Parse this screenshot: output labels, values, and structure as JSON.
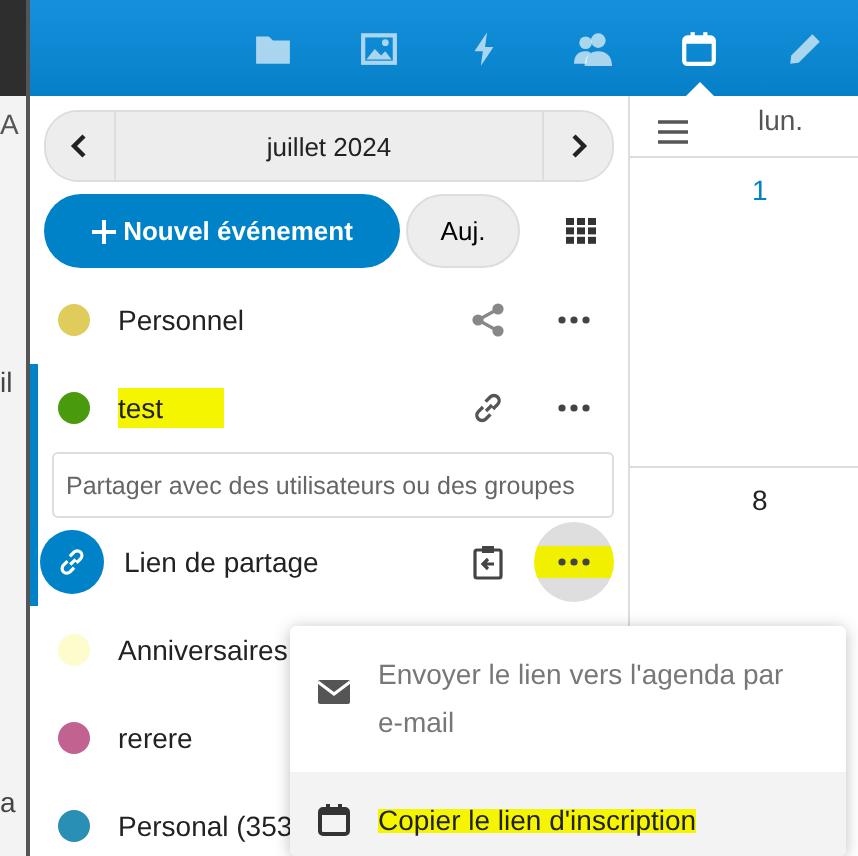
{
  "background_window": {
    "fragments": [
      "A",
      "il",
      "a"
    ]
  },
  "app_menu": [
    {
      "kind": "folder",
      "selected": false
    },
    {
      "kind": "image",
      "selected": false
    },
    {
      "kind": "bolt",
      "selected": false
    },
    {
      "kind": "people",
      "selected": false
    },
    {
      "kind": "calendar",
      "selected": true
    },
    {
      "kind": "pencil",
      "selected": false
    }
  ],
  "month_nav": {
    "label": "juillet 2024"
  },
  "new_event_button": {
    "label": "Nouvel événement"
  },
  "today_button": {
    "label": "Auj."
  },
  "calendars": [
    {
      "name": "Personnel",
      "color": "#e0cc5a",
      "kind": "share",
      "selected": false,
      "highlighted": false
    },
    {
      "name": "test",
      "color": "#4a9a0e",
      "kind": "link",
      "selected": true,
      "highlighted": true,
      "sharing": {
        "placeholder": "Partager avec des utilisateurs ou des groupes",
        "link_label": "Lien de partage",
        "link_highlighted": true
      }
    },
    {
      "name": "Anniversaires",
      "color": "#fcfccc",
      "kind": "plain",
      "selected": false,
      "highlighted": false
    },
    {
      "name": "rerere",
      "color": "#c16290",
      "kind": "plain",
      "selected": false,
      "highlighted": false
    },
    {
      "name": "Personal (353",
      "color": "#2a8fb5",
      "kind": "plain",
      "selected": false,
      "highlighted": false
    }
  ],
  "popup_menu": {
    "items": [
      {
        "kind": "mail",
        "label": "Envoyer le lien vers l'agenda par e-mail",
        "active": false,
        "highlighted": false
      },
      {
        "kind": "calendar",
        "label": "Copier le lien d'inscription",
        "active": true,
        "highlighted": true
      }
    ]
  },
  "calendar_view": {
    "weekday": "lun.",
    "days": [
      {
        "label": "1",
        "today": true
      },
      {
        "label": "8",
        "today": false
      }
    ]
  }
}
